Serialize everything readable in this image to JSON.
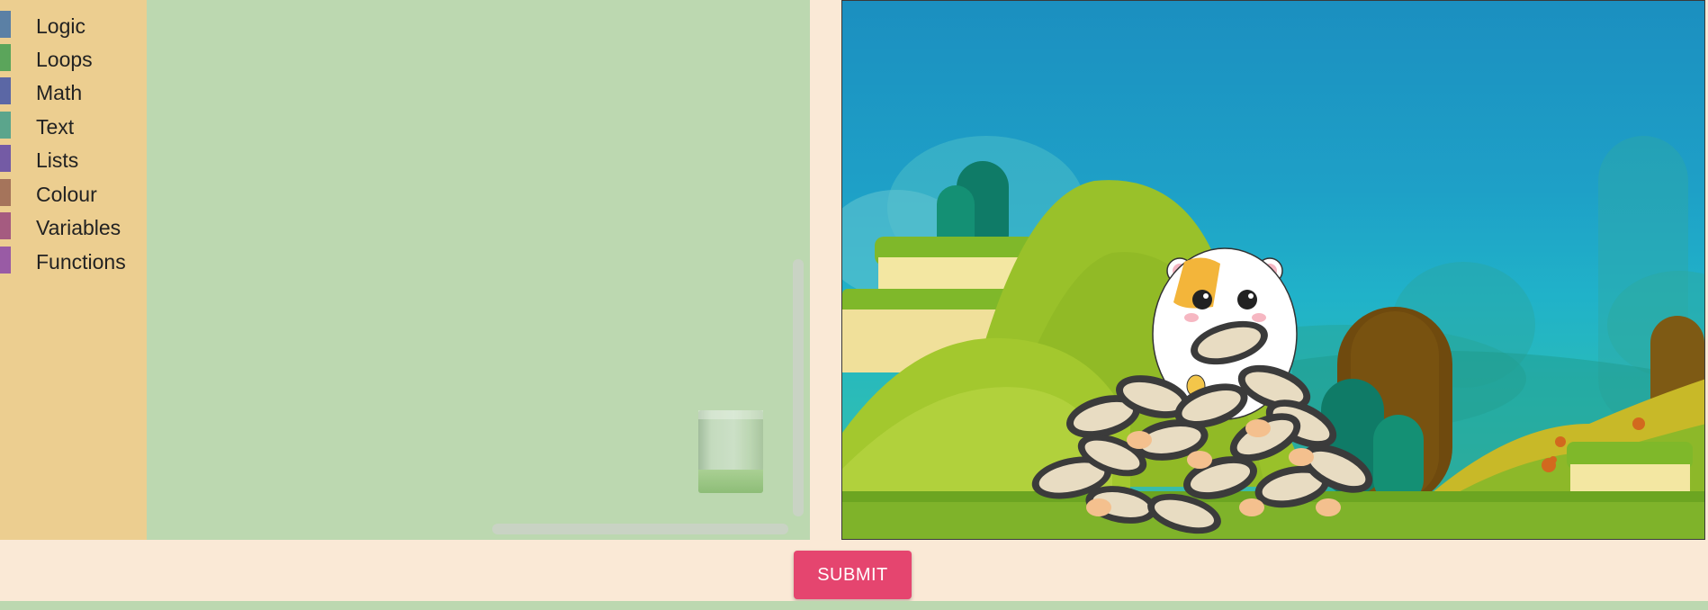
{
  "toolbox": {
    "categories": [
      {
        "label": "Logic",
        "color": "#5b80a5"
      },
      {
        "label": "Loops",
        "color": "#5ba55b"
      },
      {
        "label": "Math",
        "color": "#5b67a5"
      },
      {
        "label": "Text",
        "color": "#5ba58c"
      },
      {
        "label": "Lists",
        "color": "#745ba5"
      },
      {
        "label": "Colour",
        "color": "#a5745b"
      },
      {
        "label": "Variables",
        "color": "#a55b80"
      },
      {
        "label": "Functions",
        "color": "#995ba5"
      }
    ]
  },
  "actions": {
    "submit_label": "SUBMIT"
  },
  "icons": {
    "trash": "trash-can-icon"
  },
  "colors": {
    "toolbox_bg": "#ecce90",
    "workspace_bg": "#bcd8b0",
    "page_bg": "#fae9d6",
    "submit_bg": "#e5456f"
  }
}
